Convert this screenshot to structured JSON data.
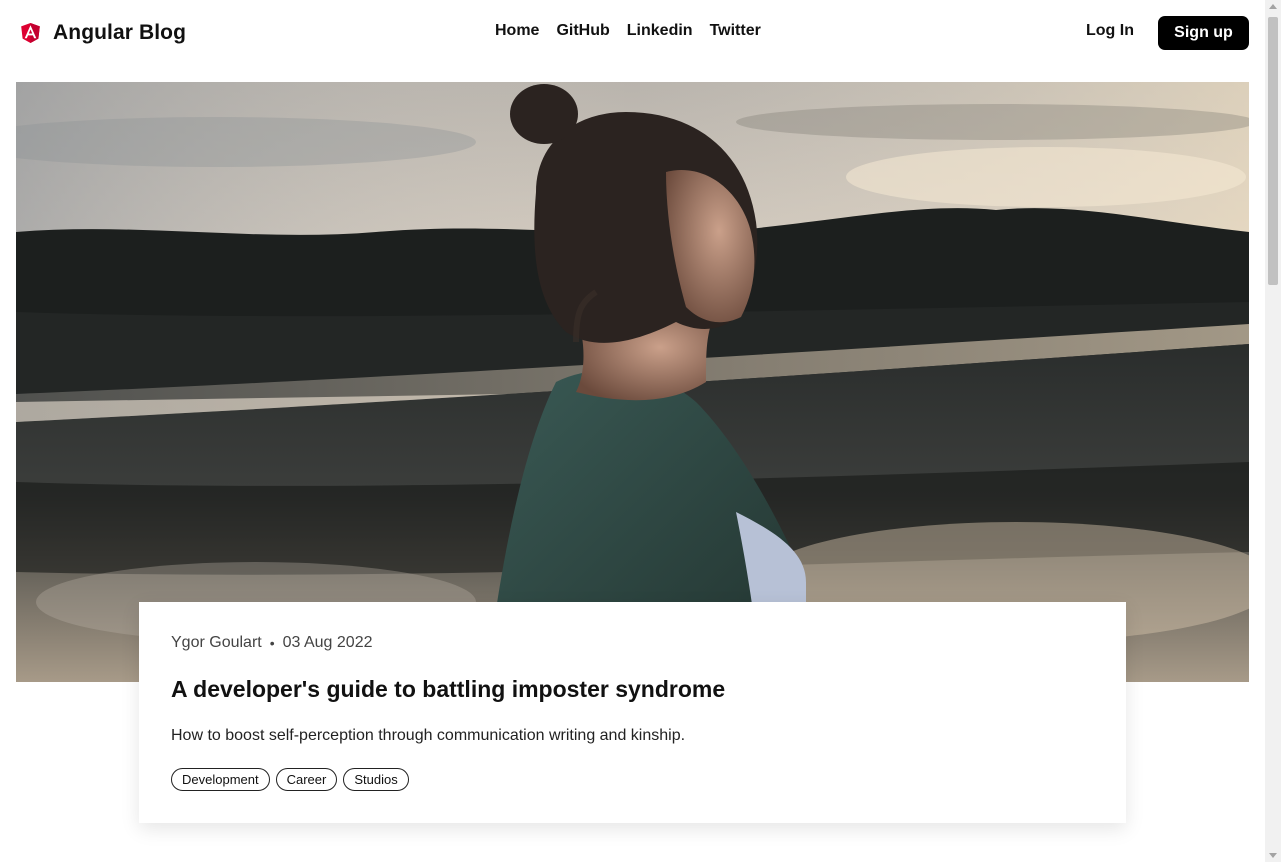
{
  "header": {
    "brand_name": "Angular Blog",
    "nav": [
      "Home",
      "GitHub",
      "Linkedin",
      "Twitter"
    ],
    "login_label": "Log In",
    "signup_label": "Sign up"
  },
  "post": {
    "author": "Ygor Goulart",
    "separator": "•",
    "date": "03 Aug 2022",
    "title": "A developer's guide to battling imposter syndrome",
    "description": "How to boost self-perception through communication writing and kinship.",
    "tags": [
      "Development",
      "Career",
      "Studios"
    ]
  },
  "icons": {
    "brand_logo": "angular-logo-icon"
  },
  "colors": {
    "brand_red": "#dd0031",
    "signup_bg": "#000000"
  }
}
